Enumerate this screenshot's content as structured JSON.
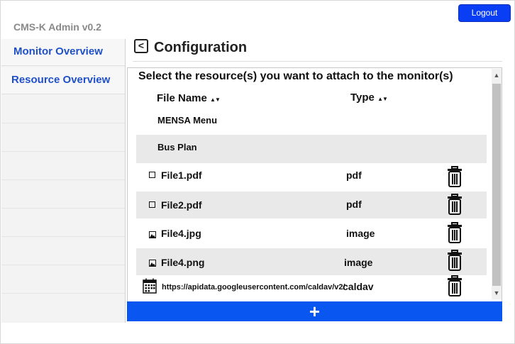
{
  "app": {
    "title": "CMS-K Admin v0.2"
  },
  "header": {
    "logout_label": "Logout"
  },
  "sidebar": {
    "items": [
      {
        "label": "Monitor Overview"
      },
      {
        "label": "Resource Overview"
      }
    ]
  },
  "page": {
    "back_label": "<",
    "title": "Configuration"
  },
  "resources": {
    "prompt": "Select the resource(s) you want to attach to the monitor(s)",
    "columns": {
      "file_name": "File Name",
      "type": "Type",
      "sort_glyph": "▲▼"
    },
    "upper_rows": [
      {
        "name": "MENSA Menu"
      },
      {
        "name": "Bus Plan"
      }
    ],
    "rows": [
      {
        "name": "File1.pdf",
        "type": "pdf",
        "icon": "checkbox-icon"
      },
      {
        "name": "File2.pdf",
        "type": "pdf",
        "icon": "checkbox-icon"
      },
      {
        "name": "File4.jpg",
        "type": "image",
        "icon": "image-file-icon"
      },
      {
        "name": "File4.png",
        "type": "image",
        "icon": "image-file-icon"
      },
      {
        "name": "https://apidata.googleusercontent.com/caldav/v2/",
        "type": "caldav",
        "icon": "calendar-icon"
      }
    ],
    "add_label": "+"
  },
  "colors": {
    "accent": "#0a56f0",
    "logout": "#0a3ef5",
    "nav_text": "#1f50c8"
  }
}
